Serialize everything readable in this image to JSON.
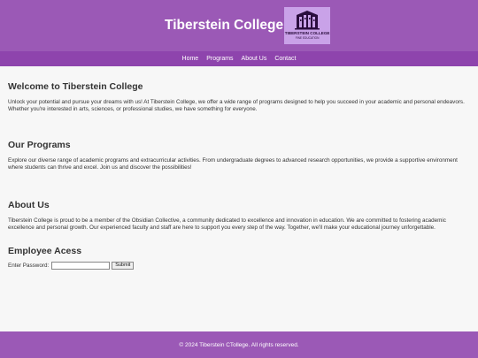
{
  "header": {
    "title": "Tiberstein College",
    "logo": {
      "name": "TIBERSTEIN COLLEGE",
      "tagline": "FINE EDUCATION"
    },
    "colors": {
      "header_bg": "#9b59b6",
      "nav_bg": "#8e44ad",
      "logo_bg": "#c9a2e8"
    }
  },
  "nav": {
    "items": [
      "Home",
      "Programs",
      "About Us",
      "Contact"
    ]
  },
  "welcome": {
    "heading": "Welcome to Tiberstein College",
    "text": "Unlock your potential and pursue your dreams with us! At Tiberstein College, we offer a wide range of programs designed to help you succeed in your academic and personal endeavors. Whether you're interested in arts, sciences, or professional studies, we have something for everyone."
  },
  "programs": {
    "heading": "Our Programs",
    "text": "Explore our diverse range of academic programs and extracurricular activities. From undergraduate degrees to advanced research opportunities, we provide a supportive environment where students can thrive and excel. Join us and discover the possibilities!"
  },
  "about": {
    "heading": "About Us",
    "text": "Tiberstein College is proud to be a member of the Obsidian Collective, a community dedicated to excellence and innovation in education. We are committed to fostering academic excellence and personal growth. Our experienced faculty and staff are here to support you every step of the way. Together, we'll make your educational journey unforgettable."
  },
  "employee": {
    "heading": "Employee Acess",
    "password_label": "Enter Password:",
    "password_value": "",
    "submit_label": "Submit"
  },
  "footer": {
    "text": "© 2024 Tiberstein CTollege. All rights reserved."
  }
}
